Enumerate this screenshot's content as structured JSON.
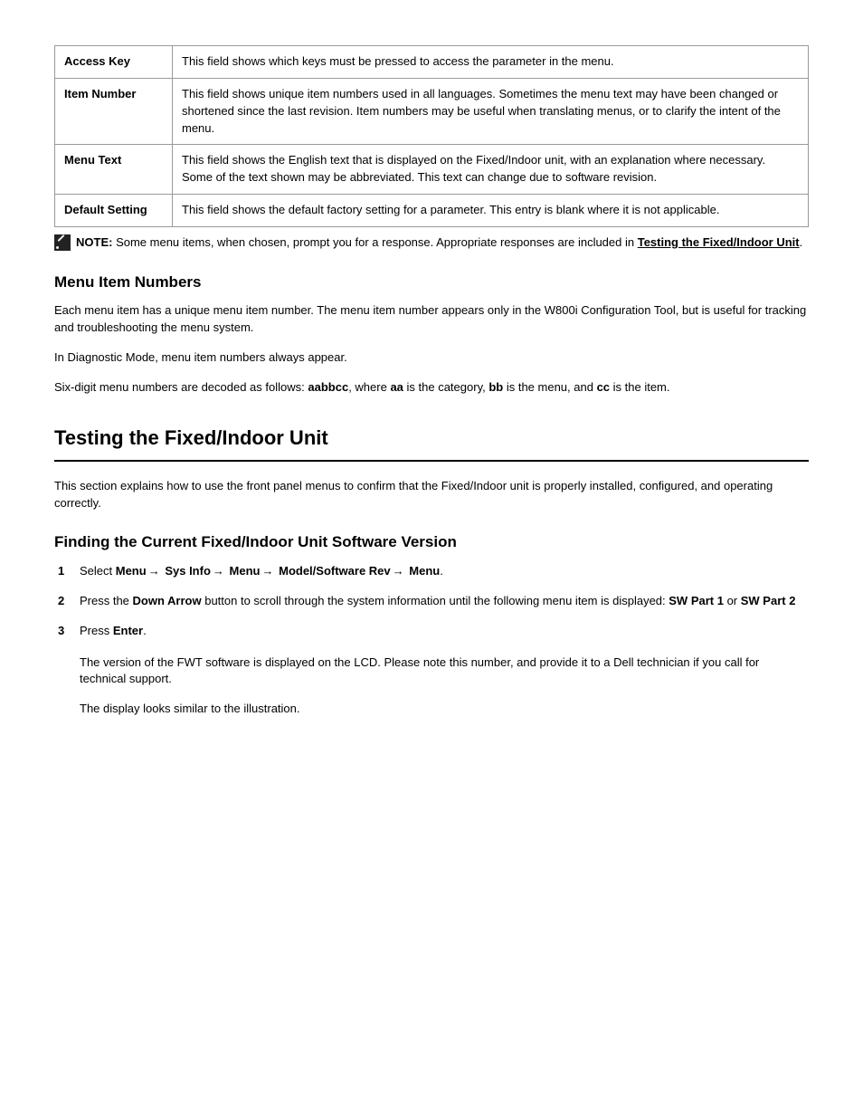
{
  "table": {
    "rows": [
      {
        "c1": "Access Key",
        "c2": "This field shows which keys must be pressed to access the parameter in the menu."
      },
      {
        "c1": "Item Number",
        "c2": "This field shows unique item numbers used in all languages. Sometimes the menu text may have been changed or shortened since the last revision. Item numbers may be useful when translating menus, or to clarify the intent of the menu."
      },
      {
        "c1": "Menu Text",
        "c2": "This field shows the English text that is displayed on the Fixed/Indoor unit, with an explanation where necessary. Some of the text shown may be abbreviated. This text can change due to software revision."
      },
      {
        "c1": "Default Setting",
        "c2": "This field shows the default factory setting for a parameter. This entry is blank where it is not applicable."
      }
    ]
  },
  "note": {
    "label": "NOTE:",
    "text_before": " Some menu items, when chosen, prompt you for a response. Appropriate responses are included in ",
    "link": "Testing the Fixed/Indoor Unit",
    "text_after": "."
  },
  "sub1": {
    "title": "Menu Item Numbers",
    "p1": "Each menu item has a unique menu item number. The menu item number appears only in the W800i Configuration Tool, but is useful for tracking and troubleshooting the menu system.",
    "p2": "In Diagnostic Mode, menu item numbers always appear.",
    "p3_prefix": "Six-digit menu numbers are decoded as follows: ",
    "p3_bold": "aabbcc",
    "p3_mid": ", where ",
    "p3_b1": "aa",
    "p3_m1": " is the category, ",
    "p3_b2": "bb",
    "p3_m2": " is the menu, and ",
    "p3_b3": "cc",
    "p3_m3": " is the item."
  },
  "section": {
    "title": "Testing the Fixed/Indoor Unit",
    "intro": "This section explains how to use the front panel menus to confirm that the Fixed/Indoor unit is properly installed, configured, and operating correctly.",
    "sub": "Finding the Current Fixed/Indoor Unit Software Version",
    "steps": [
      {
        "pre": "Select ",
        "seq": [
          "Sys Info",
          "Model/Software Rev"
        ],
        "post": "."
      },
      {
        "pre": "Press the ",
        "bold": "Down Arrow",
        "post": " button to scroll through the system information until the following menu item is displayed: ",
        "seq": [
          "SW Part 1"
        ],
        "seq2_pre": " or ",
        "seq2": [
          "SW Part 2"
        ]
      },
      {
        "pre": "Press ",
        "bold": "Enter",
        "post": "."
      }
    ],
    "after": "The version of the FWT software is displayed on the LCD. Please note this number, and provide it to a Dell technician if you call for technical support.",
    "illus_caption": "The display looks similar to the illustration."
  },
  "menu_labels": {
    "menu": "Menu",
    "sysinfo": "Sys Info",
    "model": "Model/Software",
    "rev": "Rev",
    "sw1": "SW Part 1",
    "sw2": "SW Part 2"
  }
}
